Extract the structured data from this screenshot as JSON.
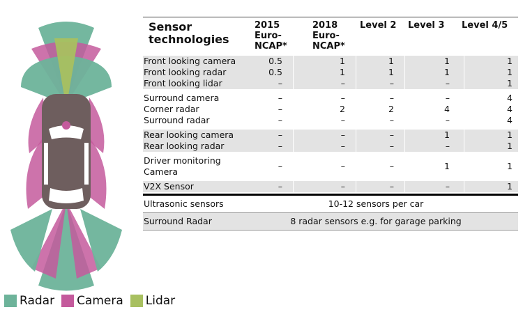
{
  "table": {
    "title": "Sensor technologies",
    "columns": [
      "2015 Euro-NCAP*",
      "2018 Euro-NCAP*",
      "Level 2",
      "Level 3",
      "Level 4/5"
    ],
    "groups": [
      {
        "shade": "grey",
        "rows": [
          {
            "label": "Front looking camera",
            "values": [
              "0.5",
              "1",
              "1",
              "1",
              "1"
            ]
          },
          {
            "label": "Front looking radar",
            "values": [
              "0.5",
              "1",
              "1",
              "1",
              "1"
            ]
          },
          {
            "label": "Front looking lidar",
            "values": [
              "–",
              "–",
              "–",
              "–",
              "1"
            ]
          }
        ]
      },
      {
        "shade": "white",
        "rows": [
          {
            "label": "Surround camera",
            "values": [
              "–",
              "–",
              "–",
              "–",
              "4"
            ]
          },
          {
            "label": "Corner radar",
            "values": [
              "–",
              "2",
              "2",
              "4",
              "4"
            ]
          },
          {
            "label": "Surround radar",
            "values": [
              "–",
              "–",
              "–",
              "–",
              "4"
            ]
          }
        ]
      },
      {
        "shade": "grey",
        "rows": [
          {
            "label": "Rear looking camera",
            "values": [
              "–",
              "–",
              "–",
              "1",
              "1"
            ]
          },
          {
            "label": "Rear looking radar",
            "values": [
              "–",
              "–",
              "–",
              "–",
              "1"
            ]
          }
        ]
      },
      {
        "shade": "white",
        "rows": [
          {
            "label": "Driver monitoring Camera",
            "values": [
              "–",
              "–",
              "–",
              "1",
              "1"
            ],
            "tall": true
          }
        ]
      },
      {
        "shade": "grey",
        "rows": [
          {
            "label": "V2X Sensor",
            "values": [
              "–",
              "–",
              "–",
              "–",
              "1"
            ]
          }
        ]
      }
    ],
    "footer_rows": [
      {
        "label": "Ultrasonic sensors",
        "text": "10-12 sensors per car"
      },
      {
        "label": "Surround Radar",
        "text": "8 radar sensors e.g. for garage parking"
      }
    ]
  },
  "legend": [
    {
      "label": "Radar",
      "color": "#6db39a"
    },
    {
      "label": "Camera",
      "color": "#c45a9c"
    },
    {
      "label": "Lidar",
      "color": "#a8c060"
    }
  ],
  "colors": {
    "car_body": "#6e5e5e",
    "car_window": "#ffffff"
  }
}
